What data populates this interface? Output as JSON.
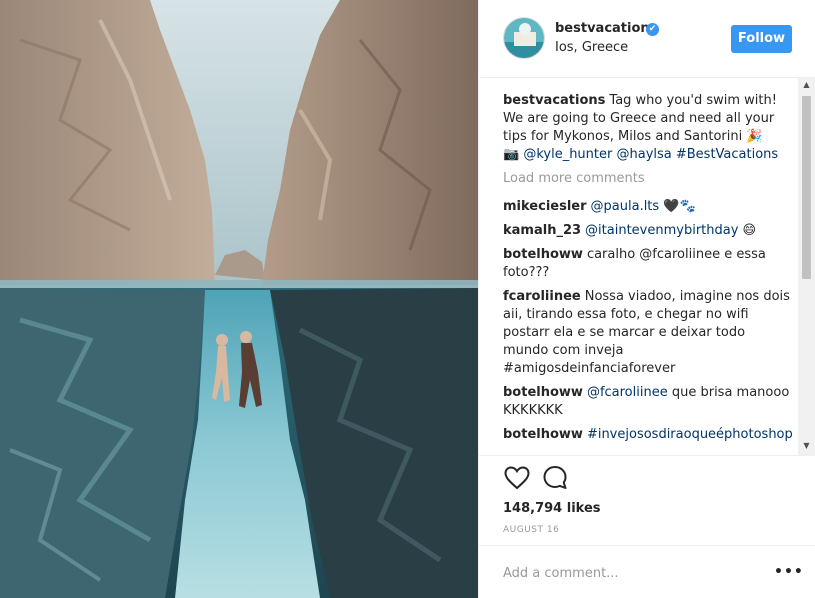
{
  "post": {
    "username": "bestvacations",
    "location": "Ios, Greece",
    "follow_label": "Follow",
    "verified_glyph": "✔",
    "caption": {
      "user": "bestvacations",
      "text": "Tag who you'd swim with! We are going to Greece and need all your tips for Mykonos, Milos and Santorini 🎉",
      "icon": "📷",
      "mentions": "@kyle_hunter @haylsa #BestVacations"
    },
    "load_more": "Load more comments",
    "comments": [
      {
        "user": "mikeciesler",
        "mention": "@paula.lts",
        "text": " 🖤🐾"
      },
      {
        "user": "kamalh_23",
        "mention": "@itaintevenmybirthday",
        "text": " 😄"
      },
      {
        "user": "botelhoww",
        "mention": "",
        "text": "caralho @fcaroliinee e essa foto???"
      },
      {
        "user": "fcaroliinee",
        "mention": "",
        "text": "Nossa viadoo, imagine nos dois aii, tirando essa foto, e chegar no wifi postarr ela e se marcar e deixar todo mundo com inveja #amigosdeinfanciaforever"
      },
      {
        "user": "botelhoww",
        "mention": "@fcaroliinee",
        "text": " que brisa manooo KKKKKKK"
      },
      {
        "user": "botelhoww",
        "mention": "#invejososdiraoqueéphotoshop",
        "text": ""
      }
    ],
    "likes": "148,794 likes",
    "date": "AUGUST 16",
    "add_comment_placeholder": "Add a comment...",
    "more_options": "•••"
  },
  "icons": {
    "heart": "heart-icon",
    "comment": "comment-bubble-icon",
    "more": "more-options-icon",
    "verified": "verified-badge-icon"
  },
  "colors": {
    "accent": "#3897f0",
    "text": "#262626",
    "muted": "#999999",
    "mention": "#003569"
  }
}
